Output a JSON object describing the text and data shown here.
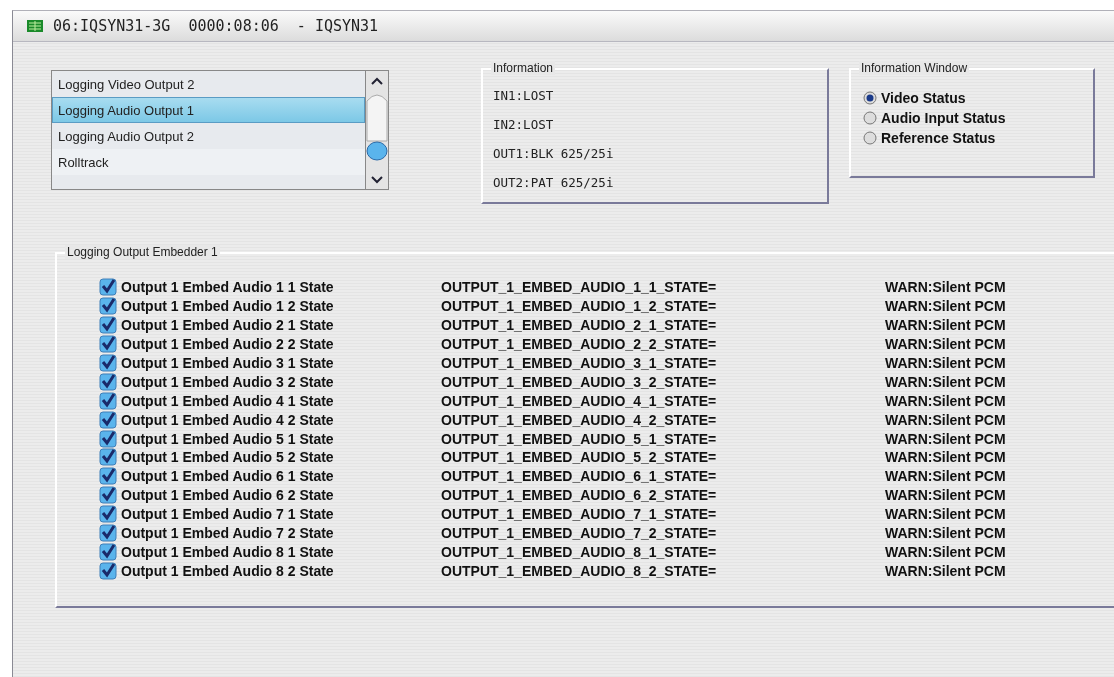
{
  "window": {
    "title": "06:IQSYN31-3G  0000:08:06  - IQSYN31"
  },
  "log_list": {
    "items": [
      {
        "label": "Logging Video Output 2",
        "selected": false
      },
      {
        "label": "Logging Audio Output 1",
        "selected": true
      },
      {
        "label": "Logging Audio Output 2",
        "selected": false
      },
      {
        "label": "Rolltrack",
        "selected": false
      }
    ]
  },
  "information": {
    "title": "Information",
    "lines": [
      "IN1:LOST",
      "IN2:LOST",
      "OUT1:BLK 625/25i",
      "OUT2:PAT 625/25i"
    ]
  },
  "information_window": {
    "title": "Information Window",
    "options": [
      {
        "label": "Video Status",
        "selected": true
      },
      {
        "label": "Audio Input Status",
        "selected": false
      },
      {
        "label": "Reference Status",
        "selected": false
      }
    ]
  },
  "embedder": {
    "title": "Logging Output Embedder 1",
    "rows": [
      {
        "label": "Output 1 Embed Audio 1 1 State",
        "key": "OUTPUT_1_EMBED_AUDIO_1_1_STATE=",
        "value": "WARN:Silent PCM",
        "checked": true
      },
      {
        "label": "Output 1 Embed Audio 1 2 State",
        "key": "OUTPUT_1_EMBED_AUDIO_1_2_STATE=",
        "value": "WARN:Silent PCM",
        "checked": true
      },
      {
        "label": "Output 1 Embed Audio 2 1 State",
        "key": "OUTPUT_1_EMBED_AUDIO_2_1_STATE=",
        "value": "WARN:Silent PCM",
        "checked": true
      },
      {
        "label": "Output 1 Embed Audio 2 2 State",
        "key": "OUTPUT_1_EMBED_AUDIO_2_2_STATE=",
        "value": "WARN:Silent PCM",
        "checked": true
      },
      {
        "label": "Output 1 Embed Audio 3 1 State",
        "key": "OUTPUT_1_EMBED_AUDIO_3_1_STATE=",
        "value": "WARN:Silent PCM",
        "checked": true
      },
      {
        "label": "Output 1 Embed Audio 3 2 State",
        "key": "OUTPUT_1_EMBED_AUDIO_3_2_STATE=",
        "value": "WARN:Silent PCM",
        "checked": true
      },
      {
        "label": "Output 1 Embed Audio 4 1 State",
        "key": "OUTPUT_1_EMBED_AUDIO_4_1_STATE=",
        "value": "WARN:Silent PCM",
        "checked": true
      },
      {
        "label": "Output 1 Embed Audio 4 2 State",
        "key": "OUTPUT_1_EMBED_AUDIO_4_2_STATE=",
        "value": "WARN:Silent PCM",
        "checked": true
      },
      {
        "label": "Output 1 Embed Audio 5 1 State",
        "key": "OUTPUT_1_EMBED_AUDIO_5_1_STATE=",
        "value": "WARN:Silent PCM",
        "checked": true
      },
      {
        "label": "Output 1 Embed Audio 5 2 State",
        "key": "OUTPUT_1_EMBED_AUDIO_5_2_STATE=",
        "value": "WARN:Silent PCM",
        "checked": true
      },
      {
        "label": "Output 1 Embed Audio 6 1 State",
        "key": "OUTPUT_1_EMBED_AUDIO_6_1_STATE=",
        "value": "WARN:Silent PCM",
        "checked": true
      },
      {
        "label": "Output 1 Embed Audio 6 2 State",
        "key": "OUTPUT_1_EMBED_AUDIO_6_2_STATE=",
        "value": "WARN:Silent PCM",
        "checked": true
      },
      {
        "label": "Output 1 Embed Audio 7 1 State",
        "key": "OUTPUT_1_EMBED_AUDIO_7_1_STATE=",
        "value": "WARN:Silent PCM",
        "checked": true
      },
      {
        "label": "Output 1 Embed Audio 7 2 State",
        "key": "OUTPUT_1_EMBED_AUDIO_7_2_STATE=",
        "value": "WARN:Silent PCM",
        "checked": true
      },
      {
        "label": "Output 1 Embed Audio 8 1 State",
        "key": "OUTPUT_1_EMBED_AUDIO_8_1_STATE=",
        "value": "WARN:Silent PCM",
        "checked": true
      },
      {
        "label": "Output 1 Embed Audio 8 2 State",
        "key": "OUTPUT_1_EMBED_AUDIO_8_2_STATE=",
        "value": "WARN:Silent PCM",
        "checked": true
      }
    ]
  }
}
